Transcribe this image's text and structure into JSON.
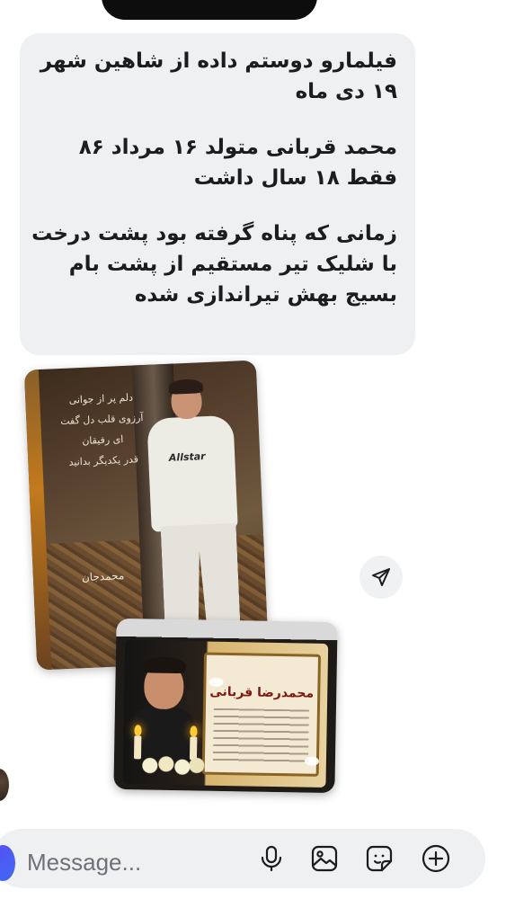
{
  "message": {
    "paragraphs": [
      [
        "فیلمارو دوستم داده از شاهین شهر",
        "۱۹ دی ماه"
      ],
      [
        "محمد قربانی متولد ۱۶ مرداد ۸۶",
        "فقط ۱۸ سال داشت"
      ],
      [
        "زمانی که پناه گرفته بود پشت درخت",
        "با شلیک تیر مستقیم از پشت بام",
        "بسیج بهش تیراندازی شده"
      ]
    ]
  },
  "photos": {
    "memorial": {
      "poem_lines": [
        "دلم پر از جوانی",
        "آرزوی قلب دل گفت",
        "ای رفیقان",
        "قدر یکدیگر بدانید"
      ],
      "caption": "محمدجان",
      "jacket_text": "Allstar"
    },
    "notice": {
      "name": "محمدرضا قربانی"
    }
  },
  "composer": {
    "placeholder": "Message..."
  },
  "icons": {
    "share": "send-icon",
    "mic": "microphone-icon",
    "gallery": "image-icon",
    "sticker": "sticker-icon",
    "add": "plus-icon",
    "camera": "camera-icon"
  },
  "colors": {
    "bubble": "#eff0f2",
    "text": "#1c1c1e",
    "accent": "#4a5af5"
  }
}
